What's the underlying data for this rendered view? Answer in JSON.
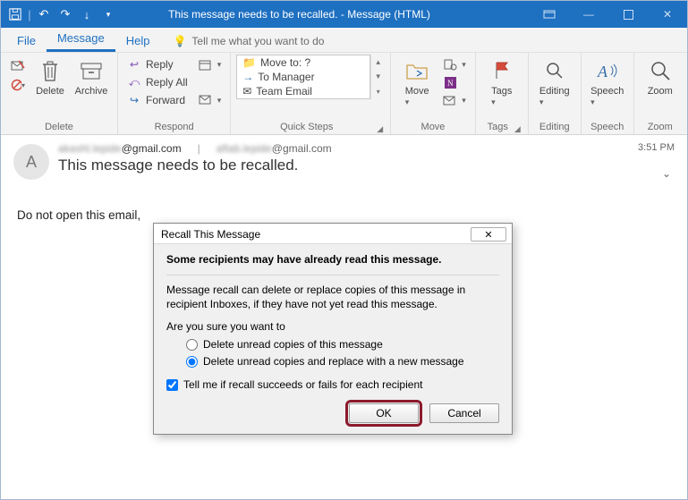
{
  "titlebar": {
    "title": "This message needs to be recalled.  -  Message (HTML)"
  },
  "menu": {
    "file": "File",
    "message": "Message",
    "help": "Help",
    "tell": "Tell me what you want to do"
  },
  "ribbon": {
    "delete_group": "Delete",
    "delete": "Delete",
    "archive": "Archive",
    "respond_group": "Respond",
    "reply": "Reply",
    "reply_all": "Reply All",
    "forward": "Forward",
    "quicksteps_group": "Quick Steps",
    "qs_moveto": "Move to: ?",
    "qs_manager": "To Manager",
    "qs_team": "Team Email",
    "move_group": "Move",
    "move": "Move",
    "tags_group": "Tags",
    "tags": "Tags",
    "editing_group": "Editing",
    "editing": "Editing",
    "speech_group": "Speech",
    "speech": "Speech",
    "zoom_group": "Zoom",
    "zoom": "Zoom"
  },
  "message": {
    "avatar_initial": "A",
    "from_blur": "akasht.lepide",
    "from_domain": "@gmail.com",
    "to_blur": "aftab.lepide",
    "to_domain": "@gmail.com",
    "subject": "This message needs to be recalled.",
    "time": "3:51 PM",
    "body": "Do not open this email,"
  },
  "dialog": {
    "title": "Recall This Message",
    "heading": "Some recipients may have already read this message.",
    "explain": "Message recall can delete or replace copies of this message in recipient Inboxes, if they have not yet read this message.",
    "question": "Are you sure you want to",
    "opt_delete": "Delete unread copies of this message",
    "opt_replace": "Delete unread copies and replace with a new message",
    "tellme": "Tell me if recall succeeds or fails for each recipient",
    "ok": "OK",
    "cancel": "Cancel",
    "selected_option": "replace",
    "tellme_checked": true
  }
}
